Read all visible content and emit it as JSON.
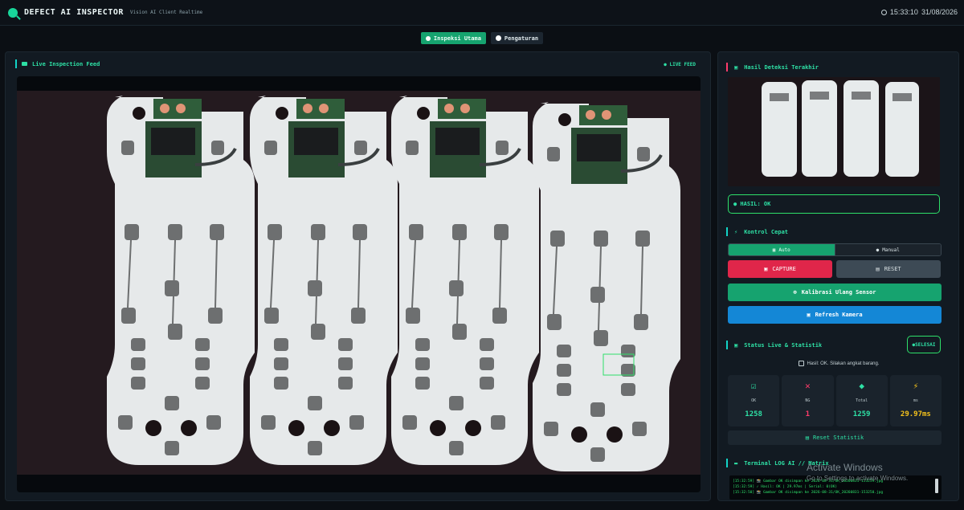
{
  "app": {
    "title": "DEFECT AI INSPECTOR",
    "subtitle": "Vision AI Client Realtime",
    "time": "15:33:10",
    "date": "31/08/2026"
  },
  "tabs": [
    {
      "label": "Inspeksi Utama",
      "active": true,
      "icon": "search-icon"
    },
    {
      "label": "Pengaturan",
      "active": false,
      "icon": "gear-icon"
    }
  ],
  "feed": {
    "title": "Live Inspection Feed",
    "badge": "● LIVE FEED"
  },
  "sidebar": {
    "last_detection_title": "Hasil Deteksi Terakhir",
    "result": "● HASIL: OK",
    "quick_control_title": "Kontrol Cepat",
    "mode_auto": "Auto",
    "mode_manual": "Manual",
    "capture": "CAPTURE",
    "reset": "RESET",
    "calibrate": "Kalibrasi Ulang Sensor",
    "refresh": "Refresh Kamera",
    "status_title": "Status Live & Statistik",
    "selesai": "●SELESAI",
    "hint": "Hasil: OK. Silakan angkat barang.",
    "stats": [
      {
        "label": "OK",
        "value": "1258",
        "color": "#2ee0a5",
        "icon": "check-icon"
      },
      {
        "label": "NG",
        "value": "1",
        "color": "#ff3b6b",
        "icon": "cross-icon"
      },
      {
        "label": "Total",
        "value": "1259",
        "color": "#2ee0a5",
        "icon": "box-icon"
      },
      {
        "label": "ms",
        "value": "29.97ms",
        "color": "#f4c21c",
        "icon": "bolt-icon"
      }
    ],
    "reset_stat": "Reset Statistik",
    "log_title": "Terminal LOG AI // Matrix",
    "log_lines": [
      "[15:32:59] 📸 Gambar OK disimpan ke 2026-08-31/OK_20260831-153259.jpg",
      "[15:32:59] ✓ Hasil: OK  |  29.97ms  |  Serial: 0(OK)",
      "[15:32:50] 📸 Gambar OK disimpan ke 2026-08-31/OK_20260831-153250.jpg"
    ]
  },
  "watermark": {
    "line1": "Activate Windows",
    "line2": "Go to Settings to activate Windows."
  },
  "colors": {
    "accent": "#2ee0a5",
    "danger": "#e0264a",
    "primary": "#16a36f",
    "info": "#1487d6"
  }
}
